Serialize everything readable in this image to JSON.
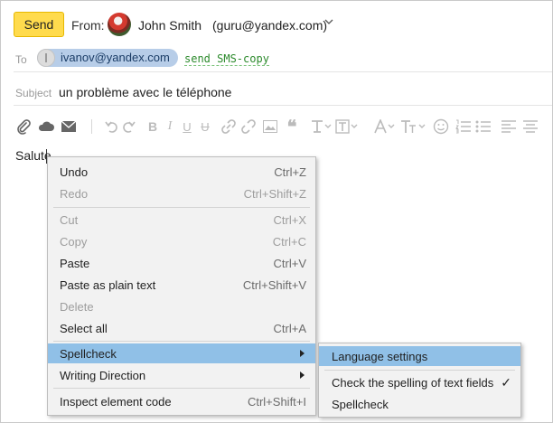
{
  "header": {
    "send_label": "Send",
    "from_label": "From:",
    "from_name": "John Smith",
    "from_email": "(guru@yandex.com)",
    "to_label": "To",
    "recipient": "ivanov@yandex.com",
    "sms_link": "send SMS-copy",
    "subject_label": "Subject",
    "subject_value": "un problème avec le téléphone"
  },
  "body": {
    "text": "Salute"
  },
  "toolbar": {
    "icons": [
      "attach-icon",
      "cloud-icon",
      "envelope-icon",
      "undo-icon",
      "redo-icon",
      "bold-icon",
      "italic-icon",
      "underline-icon",
      "strikethrough-icon",
      "link-icon",
      "unlink-icon",
      "image-icon",
      "quote-icon",
      "text-style-icon",
      "text-block-icon",
      "font-color-icon",
      "font-size-icon",
      "emoji-icon",
      "numbered-list-icon",
      "bullet-list-icon",
      "align-left-icon",
      "align-center-icon"
    ]
  },
  "context_menu": {
    "items": [
      {
        "label": "Undo",
        "shortcut": "Ctrl+Z"
      },
      {
        "label": "Redo",
        "shortcut": "Ctrl+Shift+Z"
      },
      {
        "label": "Cut",
        "shortcut": "Ctrl+X"
      },
      {
        "label": "Copy",
        "shortcut": "Ctrl+C"
      },
      {
        "label": "Paste",
        "shortcut": "Ctrl+V"
      },
      {
        "label": "Paste as plain text",
        "shortcut": "Ctrl+Shift+V"
      },
      {
        "label": "Delete",
        "shortcut": ""
      },
      {
        "label": "Select all",
        "shortcut": "Ctrl+A"
      },
      {
        "label": "Spellcheck",
        "shortcut": ""
      },
      {
        "label": "Writing Direction",
        "shortcut": ""
      },
      {
        "label": "Inspect element code",
        "shortcut": "Ctrl+Shift+I"
      }
    ]
  },
  "submenu": {
    "items": [
      {
        "label": "Language settings"
      },
      {
        "label": "Check the spelling of text fields",
        "check": "✓"
      },
      {
        "label": "Spellcheck"
      }
    ]
  },
  "colors": {
    "send_button": "#ffdb4d",
    "highlight": "#90c0e7",
    "recipient_chip": "#b7cde8",
    "sms_link": "#2c8a2c"
  }
}
